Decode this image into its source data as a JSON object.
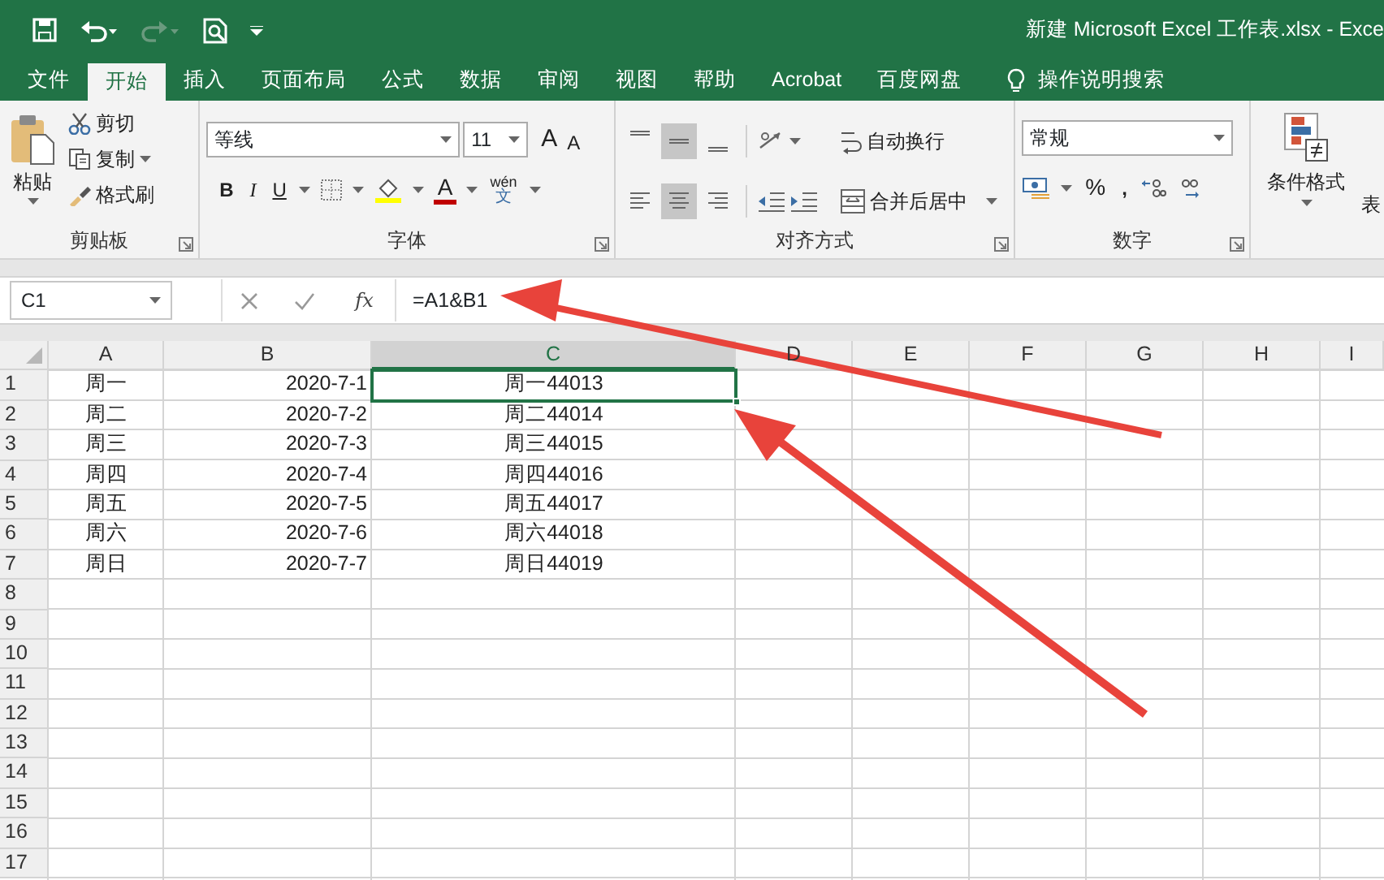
{
  "title_bar": {
    "title": "新建 Microsoft Excel 工作表.xlsx  -  Exce"
  },
  "tabs": [
    {
      "label": "文件",
      "selected": false
    },
    {
      "label": "开始",
      "selected": true
    },
    {
      "label": "插入",
      "selected": false
    },
    {
      "label": "页面布局",
      "selected": false
    },
    {
      "label": "公式",
      "selected": false
    },
    {
      "label": "数据",
      "selected": false
    },
    {
      "label": "审阅",
      "selected": false
    },
    {
      "label": "视图",
      "selected": false
    },
    {
      "label": "帮助",
      "selected": false
    },
    {
      "label": "Acrobat",
      "selected": false
    },
    {
      "label": "百度网盘",
      "selected": false
    }
  ],
  "tell_me": "操作说明搜索",
  "ribbon": {
    "clipboard": {
      "label": "剪贴板",
      "paste": "粘贴",
      "cut": "剪切",
      "copy": "复制",
      "format_painter": "格式刷"
    },
    "font": {
      "label": "字体",
      "font_name": "等线",
      "font_size": "11",
      "grow": "A",
      "shrink": "A",
      "bold": "B",
      "italic": "I",
      "underline": "U",
      "font_color": "A",
      "phonetic": "wén",
      "phonetic_char": "文"
    },
    "alignment": {
      "label": "对齐方式",
      "vertical": [
        {
          "selected": false
        },
        {
          "selected": true
        },
        {
          "selected": false
        }
      ],
      "horizontal": [
        {
          "selected": false
        },
        {
          "selected": true
        },
        {
          "selected": false
        }
      ],
      "wrap_text": "自动换行",
      "merge_center": "合并后居中"
    },
    "number": {
      "label": "数字",
      "format": "常规",
      "percent": "%",
      "comma": ","
    },
    "styles": {
      "conditional_formatting": "条件格式",
      "table_format": "表"
    }
  },
  "formula_bar": {
    "name_box": "C1",
    "fx": "fx",
    "formula": "=A1&B1"
  },
  "sheet": {
    "columns": [
      {
        "label": "A",
        "selected": false
      },
      {
        "label": "B",
        "selected": false
      },
      {
        "label": "C",
        "selected": true
      },
      {
        "label": "D",
        "selected": false
      },
      {
        "label": "E",
        "selected": false
      },
      {
        "label": "F",
        "selected": false
      },
      {
        "label": "G",
        "selected": false
      },
      {
        "label": "H",
        "selected": false
      },
      {
        "label": "I",
        "selected": false
      }
    ],
    "rows": [
      {
        "number": "1",
        "cells": [
          {
            "text": "周一",
            "selected": false
          },
          {
            "text": "2020-7-1",
            "selected": false
          },
          {
            "text": "周一44013",
            "selected": true
          }
        ]
      },
      {
        "number": "2",
        "cells": [
          {
            "text": "周二",
            "selected": false
          },
          {
            "text": "2020-7-2",
            "selected": false
          },
          {
            "text": "周二44014",
            "selected": false
          }
        ]
      },
      {
        "number": "3",
        "cells": [
          {
            "text": "周三",
            "selected": false
          },
          {
            "text": "2020-7-3",
            "selected": false
          },
          {
            "text": "周三44015",
            "selected": false
          }
        ]
      },
      {
        "number": "4",
        "cells": [
          {
            "text": "周四",
            "selected": false
          },
          {
            "text": "2020-7-4",
            "selected": false
          },
          {
            "text": "周四44016",
            "selected": false
          }
        ]
      },
      {
        "number": "5",
        "cells": [
          {
            "text": "周五",
            "selected": false
          },
          {
            "text": "2020-7-5",
            "selected": false
          },
          {
            "text": "周五44017",
            "selected": false
          }
        ]
      },
      {
        "number": "6",
        "cells": [
          {
            "text": "周六",
            "selected": false
          },
          {
            "text": "2020-7-6",
            "selected": false
          },
          {
            "text": "周六44018",
            "selected": false
          }
        ]
      },
      {
        "number": "7",
        "cells": [
          {
            "text": "周日",
            "selected": false
          },
          {
            "text": "2020-7-7",
            "selected": false
          },
          {
            "text": "周日44019",
            "selected": false
          }
        ]
      },
      {
        "number": "8"
      },
      {
        "number": "9"
      },
      {
        "number": "10"
      },
      {
        "number": "11"
      },
      {
        "number": "12"
      },
      {
        "number": "13"
      },
      {
        "number": "14"
      },
      {
        "number": "15"
      },
      {
        "number": "16"
      },
      {
        "number": "17"
      }
    ]
  }
}
